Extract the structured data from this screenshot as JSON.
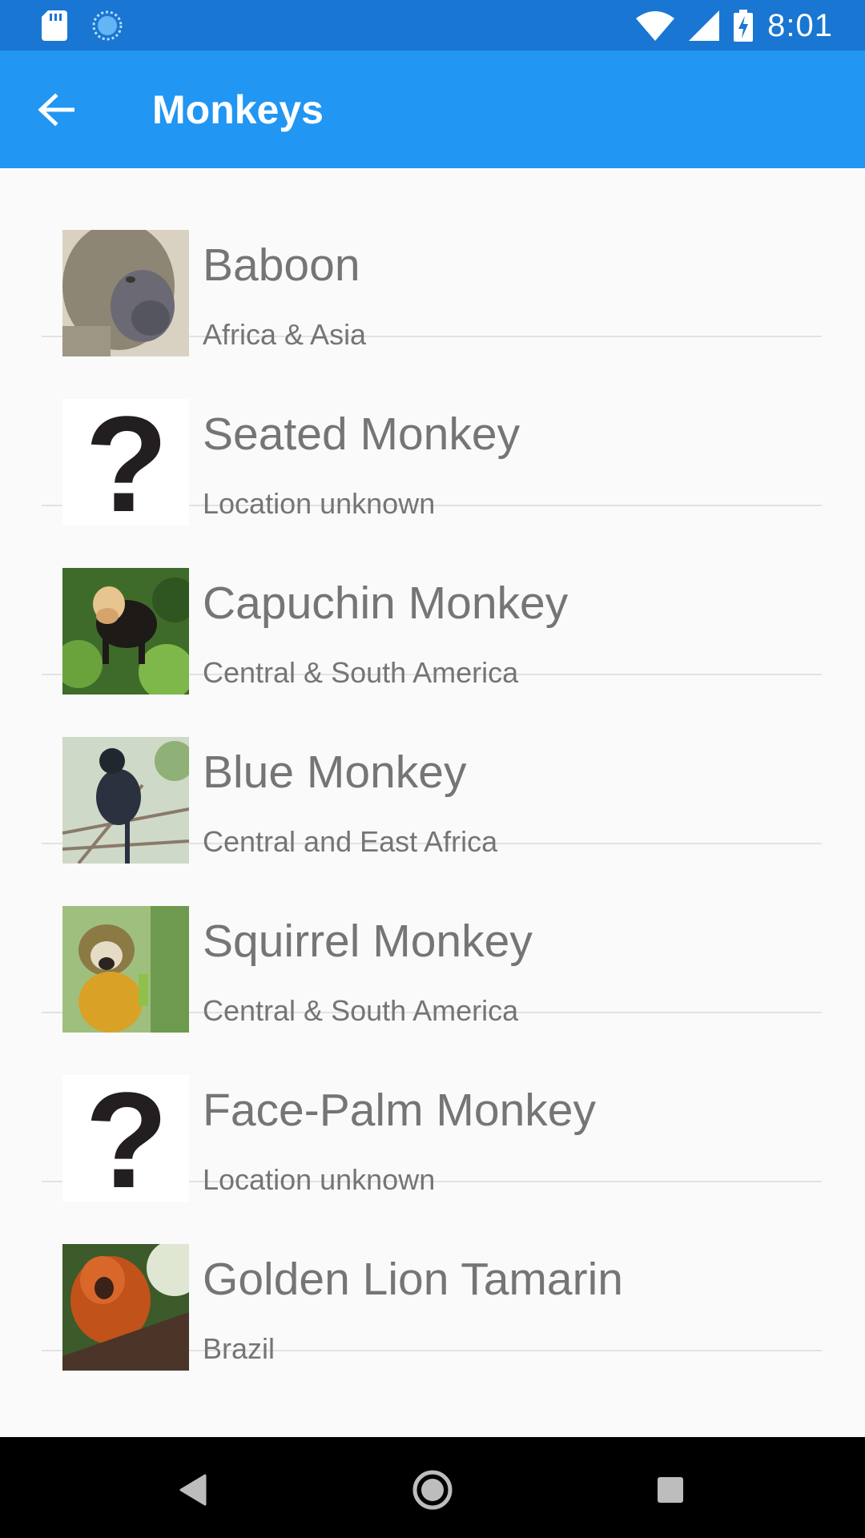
{
  "status_bar": {
    "time": "8:01",
    "icons": [
      "sd-card-icon",
      "sync-icon",
      "wifi-icon",
      "cellular-signal-icon",
      "battery-charging-icon"
    ]
  },
  "app_bar": {
    "title": "Monkeys",
    "back_icon": "arrow-back-icon"
  },
  "monkeys": [
    {
      "name": "Baboon",
      "location": "Africa & Asia",
      "image": "baboon-photo"
    },
    {
      "name": "Seated Monkey",
      "location": "Location unknown",
      "image": "question-mark-placeholder"
    },
    {
      "name": "Capuchin Monkey",
      "location": "Central & South America",
      "image": "capuchin-photo"
    },
    {
      "name": "Blue Monkey",
      "location": "Central and East Africa",
      "image": "blue-monkey-photo"
    },
    {
      "name": "Squirrel Monkey",
      "location": "Central & South America",
      "image": "squirrel-monkey-photo"
    },
    {
      "name": "Face-Palm Monkey",
      "location": "Location unknown",
      "image": "question-mark-placeholder"
    },
    {
      "name": "Golden Lion Tamarin",
      "location": "Brazil",
      "image": "golden-lion-tamarin-photo"
    }
  ],
  "nav_bar": {
    "buttons": [
      "back-triangle-icon",
      "home-circle-icon",
      "recents-square-icon"
    ]
  },
  "colors": {
    "status_bar": "#1976d2",
    "app_bar": "#2196f3",
    "background": "#fafafa",
    "text": "#757575",
    "divider": "#e2e2e2"
  }
}
